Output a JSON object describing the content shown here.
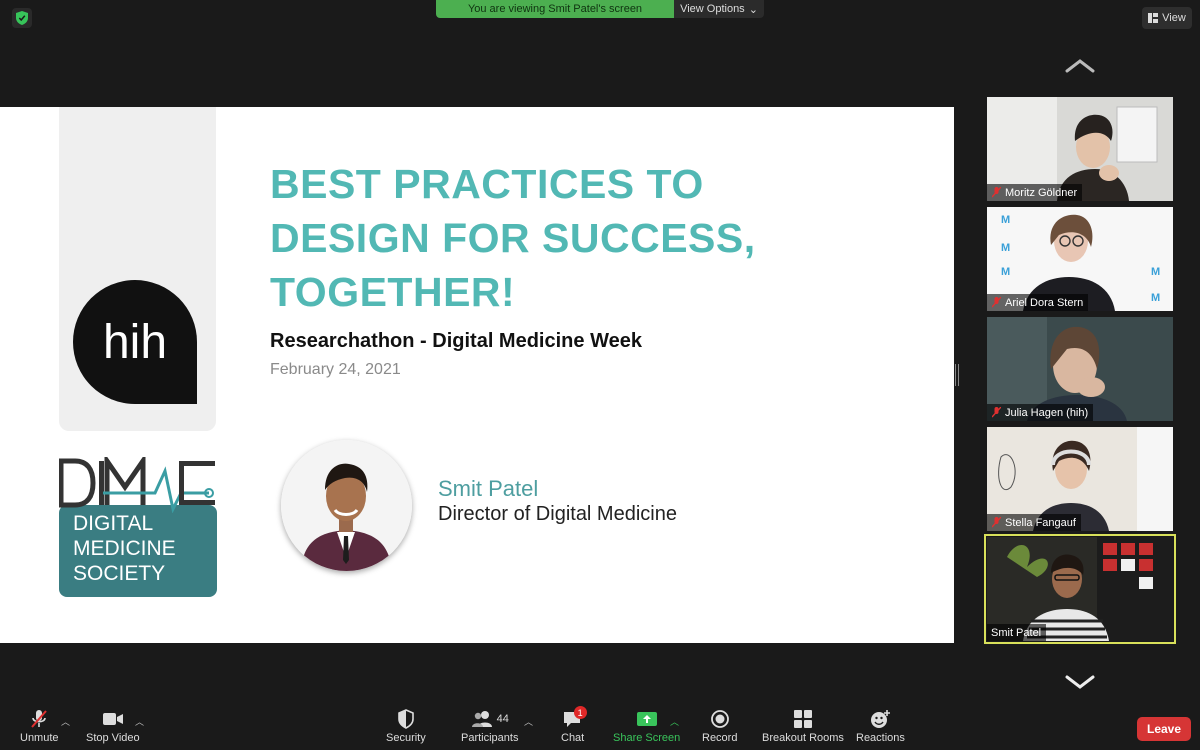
{
  "banner": {
    "viewing_text": "You are viewing Smit Patel's screen",
    "view_options_label": "View Options",
    "view_label": "View"
  },
  "slide": {
    "logo_text": "hih",
    "dime_lines": [
      "DIGITAL",
      "MEDICINE",
      "SOCIETY"
    ],
    "title_lines": [
      "BEST PRACTICES TO",
      "DESIGN FOR SUCCESS,",
      "TOGETHER!"
    ],
    "subtitle": "Researchathon - Digital Medicine Week",
    "date": "February 24, 2021",
    "speaker_name": "Smit Patel",
    "speaker_role": "Director of Digital Medicine"
  },
  "participants": [
    {
      "name": "Moritz Göldner",
      "muted": true
    },
    {
      "name": "Ariel Dora Stern",
      "muted": true
    },
    {
      "name": "Julia Hagen (hih)",
      "muted": true
    },
    {
      "name": "Stella Fangauf",
      "muted": true
    },
    {
      "name": "Smit Patel",
      "muted": false,
      "active": true
    }
  ],
  "toolbar": {
    "unmute": "Unmute",
    "stop_video": "Stop Video",
    "security": "Security",
    "participants": "Participants",
    "participants_count": "44",
    "chat": "Chat",
    "chat_badge": "1",
    "share_screen": "Share Screen",
    "record": "Record",
    "breakout_rooms": "Breakout Rooms",
    "reactions": "Reactions",
    "leave": "Leave"
  },
  "colors": {
    "accent_teal": "#52b8b4",
    "share_green": "#39c45b",
    "leave_red": "#d63535",
    "banner_green": "#4caf50",
    "active_outline": "#d8e05a"
  }
}
